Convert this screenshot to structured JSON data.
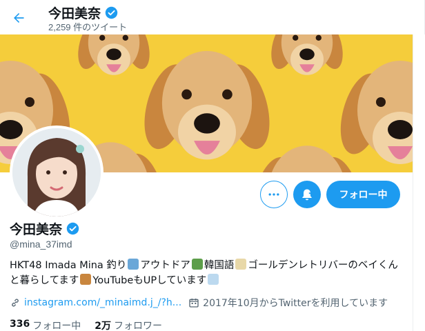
{
  "header": {
    "name": "今田美奈",
    "tweet_count": "2,259 件のツイート"
  },
  "profile": {
    "name": "今田美奈",
    "handle": "@mina_37imd",
    "bio_line1_a": "HKT48 Imada Mina 釣り",
    "bio_line1_b": "アウトドア",
    "bio_line1_c": "韓国語",
    "bio_line1_d": "ゴールデンレトリバーのベイくん",
    "bio_line2_a": "と暮らしてます",
    "bio_line2_b": "YouTubeもUPしています",
    "link": "instagram.com/_minaimd.j_/?h...",
    "joined": "2017年10月からTwitterを利用しています"
  },
  "actions": {
    "follow_label": "フォロー中"
  },
  "stats": {
    "following_count": "336",
    "following_label": "フォロー中",
    "followers_count": "2万",
    "followers_label": "フォロワー"
  },
  "colors": {
    "accent": "#1d9bf0",
    "banner": "#f5cd3b",
    "text": "#0f1419",
    "secondary_text": "#536471"
  },
  "icons": [
    "back-arrow-icon",
    "verified-badge-icon",
    "more-icon",
    "bell-icon",
    "link-icon",
    "calendar-icon"
  ]
}
